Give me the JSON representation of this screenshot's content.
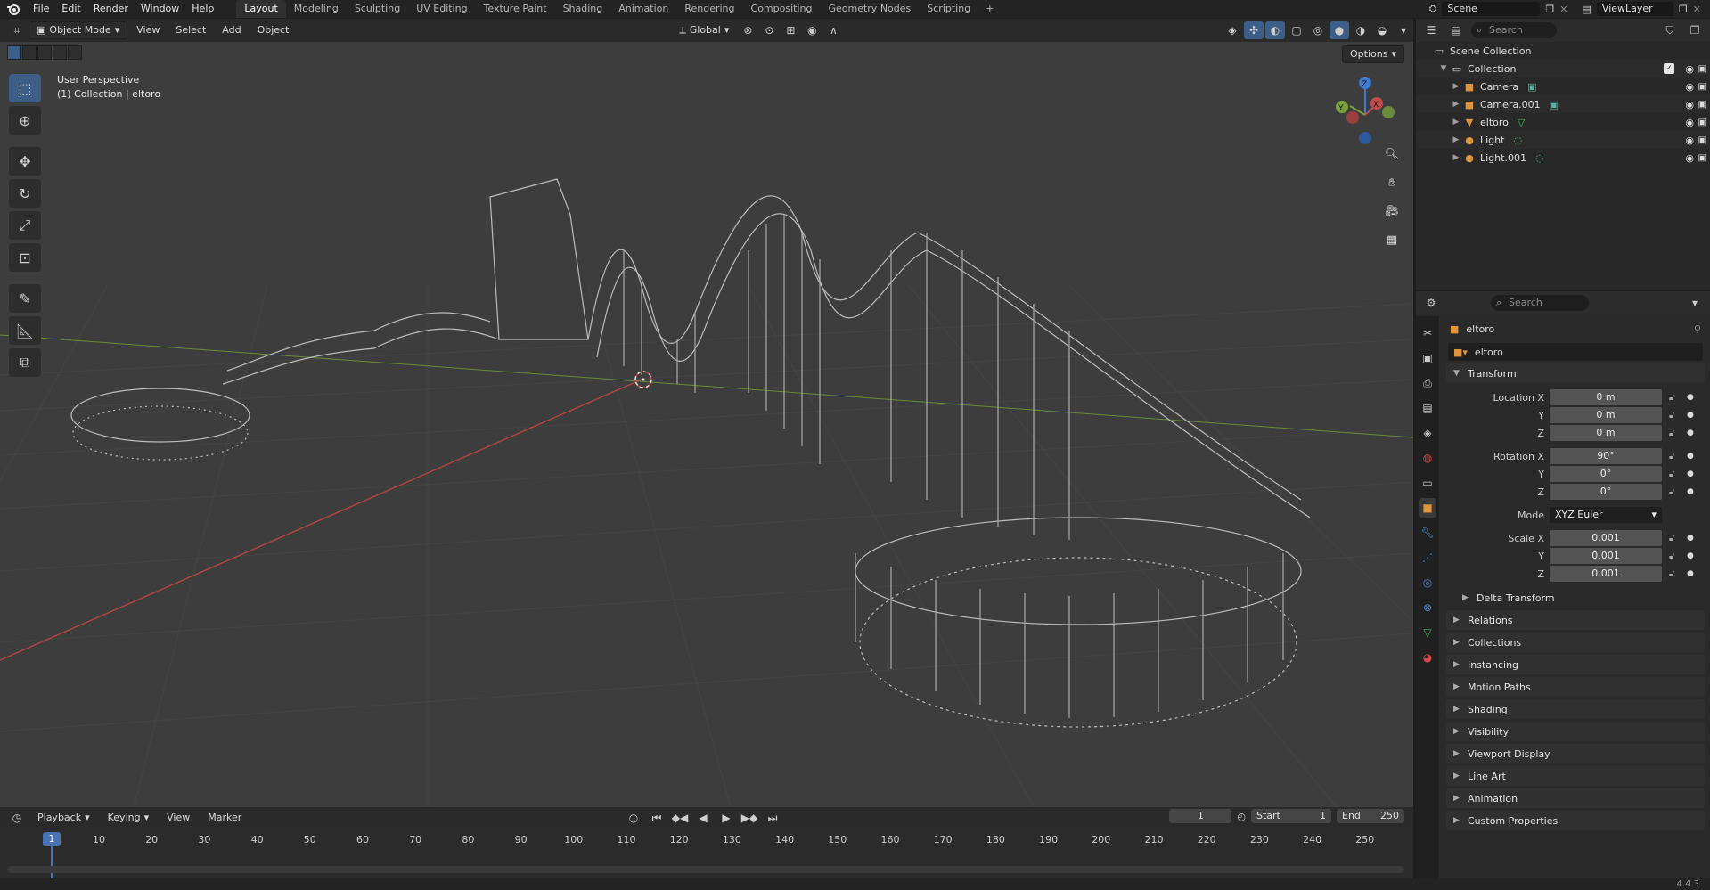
{
  "topbar": {
    "menus": [
      "File",
      "Edit",
      "Render",
      "Window",
      "Help"
    ],
    "workspaces": [
      "Layout",
      "Modeling",
      "Sculpting",
      "UV Editing",
      "Texture Paint",
      "Shading",
      "Animation",
      "Rendering",
      "Compositing",
      "Geometry Nodes",
      "Scripting"
    ],
    "active_workspace": "Layout",
    "add_symbol": "+",
    "scene": "Scene",
    "view_layer": "ViewLayer"
  },
  "viewport": {
    "mode": "Object Mode",
    "menus": [
      "View",
      "Select",
      "Add",
      "Object"
    ],
    "transform_orientation": "Global",
    "options": "Options",
    "overlay_title": "User Perspective",
    "overlay_subtitle": "(1) Collection | eltoro",
    "gizmo": {
      "x": "X",
      "y": "Y",
      "z": "Z"
    }
  },
  "timeline": {
    "menus": [
      "Playback",
      "Keying",
      "View",
      "Marker"
    ],
    "current_frame": "1",
    "start_label": "Start",
    "start": "1",
    "end_label": "End",
    "end": "250",
    "ticks": [
      "10",
      "20",
      "30",
      "40",
      "50",
      "60",
      "70",
      "80",
      "90",
      "100",
      "110",
      "120",
      "130",
      "140",
      "150",
      "160",
      "170",
      "180",
      "190",
      "200",
      "210",
      "220",
      "230",
      "240",
      "250"
    ],
    "cursor_label": "1"
  },
  "outliner": {
    "search_placeholder": "Search",
    "scene_collection": "Scene Collection",
    "collection": "Collection",
    "items": [
      {
        "name": "Camera",
        "icon": "camera-icon",
        "color": "#e0953a"
      },
      {
        "name": "Camera.001",
        "icon": "camera-icon",
        "color": "#e0953a"
      },
      {
        "name": "eltoro",
        "icon": "mesh-icon",
        "color": "#e0953a"
      },
      {
        "name": "Light",
        "icon": "light-icon",
        "color": "#e0953a"
      },
      {
        "name": "Light.001",
        "icon": "light-icon",
        "color": "#e0953a"
      }
    ]
  },
  "properties": {
    "search_placeholder": "Search",
    "object_name": "eltoro",
    "datablock_name": "eltoro",
    "transform_label": "Transform",
    "location_label": "Location X",
    "location": [
      "0 m",
      "0 m",
      "0 m"
    ],
    "rotation_label": "Rotation X",
    "rotation": [
      "90°",
      "0°",
      "0°"
    ],
    "mode_label": "Mode",
    "mode_value": "XYZ Euler",
    "scale_label": "Scale X",
    "scale": [
      "0.001",
      "0.001",
      "0.001"
    ],
    "axis_y": "Y",
    "axis_z": "Z",
    "delta_transform": "Delta Transform",
    "panels": [
      "Relations",
      "Collections",
      "Instancing",
      "Motion Paths",
      "Shading",
      "Visibility",
      "Viewport Display",
      "Line Art",
      "Animation",
      "Custom Properties"
    ]
  },
  "statusbar": {
    "version": "4.4.3"
  },
  "colors": {
    "accent": "#4772b3",
    "x_axis": "#c24b4b",
    "y_axis": "#7aa03a",
    "z_axis": "#3d7ad0",
    "object_orange": "#e0953a"
  }
}
